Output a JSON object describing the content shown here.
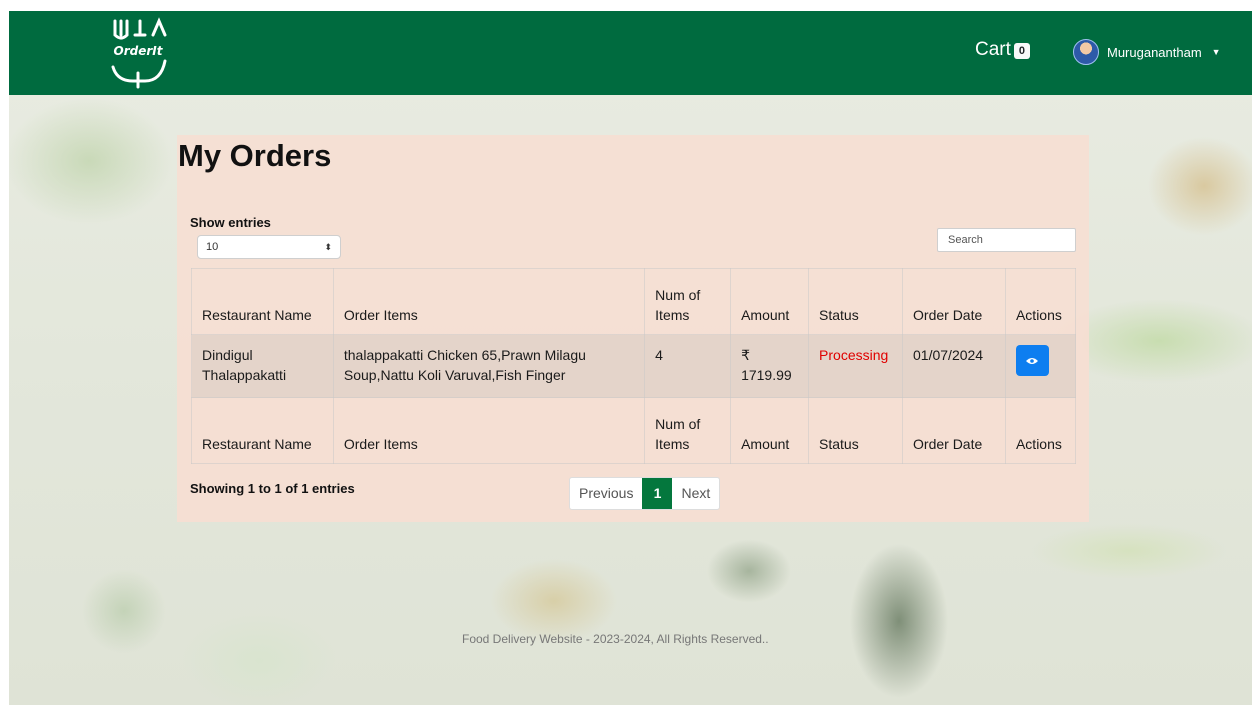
{
  "navbar": {
    "logo_text": "OrderIt",
    "cart_label": "Cart",
    "cart_count": "0",
    "user_name": "Muruganantham"
  },
  "main": {
    "title": "My Orders",
    "show_entries_label": "Show entries",
    "entries_value": "10",
    "search_placeholder": "Search",
    "columns": [
      "Restaurant Name",
      "Order Items",
      "Num of Items",
      "Amount",
      "Status",
      "Order Date",
      "Actions"
    ],
    "rows": [
      {
        "restaurant": "Dindigul Thalappakatti",
        "items": "thalappakatti Chicken 65,Prawn Milagu Soup,Nattu Koli Varuval,Fish Finger",
        "num_items": "4",
        "amount": "₹ 1719.99",
        "status": "Processing",
        "order_date": "01/07/2024"
      }
    ],
    "showing_info": "Showing 1 to 1 of 1 entries",
    "pagination": {
      "previous": "Previous",
      "current": "1",
      "next": "Next"
    }
  },
  "footer": {
    "text": "Food Delivery Website - 2023-2024, All Rights Reserved.."
  },
  "colors": {
    "navbar": "#006b3f",
    "status_processing": "#e00000",
    "action_button": "#0d7ef0",
    "page_active": "#04773d"
  }
}
